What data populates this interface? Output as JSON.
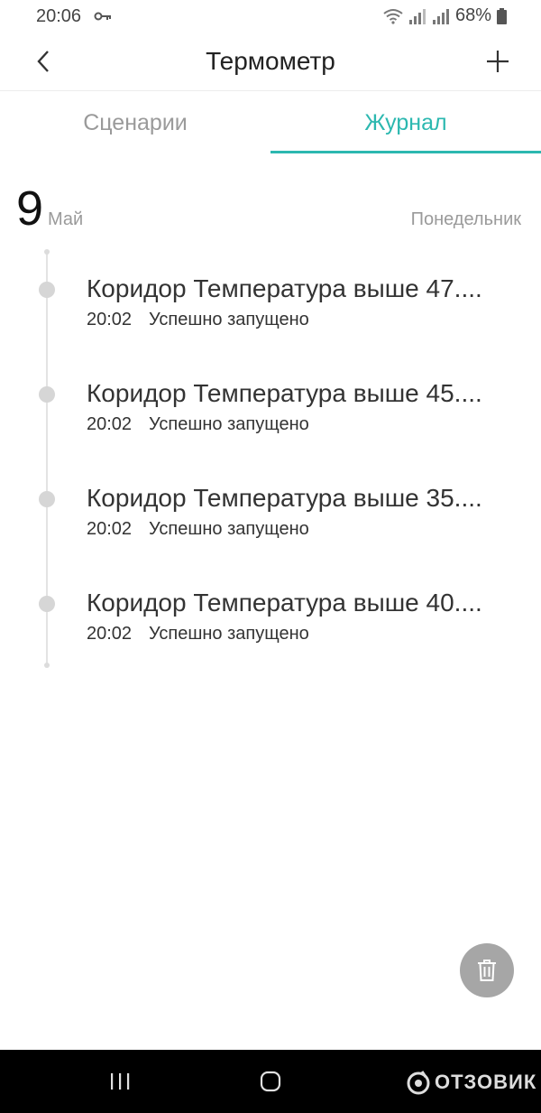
{
  "status_bar": {
    "time": "20:06",
    "battery": "68%"
  },
  "header": {
    "title": "Термометр"
  },
  "tabs": [
    {
      "label": "Сценарии",
      "active": false
    },
    {
      "label": "Журнал",
      "active": true
    }
  ],
  "date": {
    "day": "9",
    "month": "Май",
    "weekday": "Понедельник"
  },
  "entries": [
    {
      "title": "Коридор Температура выше 47....",
      "time": "20:02",
      "status": "Успешно запущено"
    },
    {
      "title": "Коридор Температура выше 45....",
      "time": "20:02",
      "status": "Успешно запущено"
    },
    {
      "title": "Коридор Температура выше 35....",
      "time": "20:02",
      "status": "Успешно запущено"
    },
    {
      "title": "Коридор Температура выше 40....",
      "time": "20:02",
      "status": "Успешно запущено"
    }
  ],
  "watermark": "ОТЗОВИК",
  "icons": {
    "back": "chevron-left-icon",
    "add": "plus-icon",
    "delete": "trash-icon",
    "key": "key-icon",
    "wifi": "wifi-icon",
    "signal": "signal-icon",
    "battery": "battery-icon",
    "nav_recent": "recent-apps-icon",
    "nav_home": "home-icon"
  },
  "colors": {
    "accent": "#2cb8b0",
    "fab": "#a6a6a6",
    "nav_bar": "#000000"
  }
}
